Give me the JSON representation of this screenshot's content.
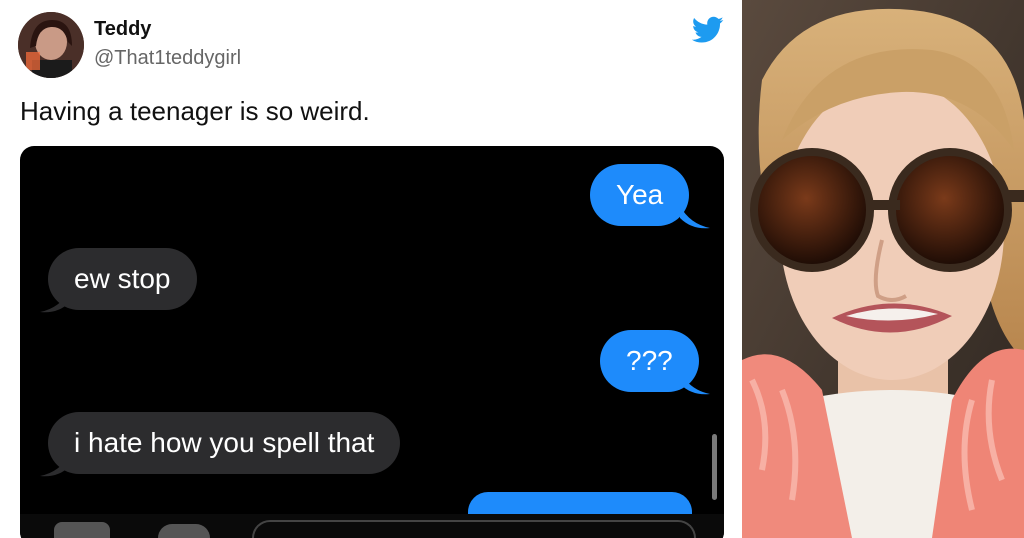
{
  "tweet": {
    "author_name": "Teddy",
    "author_handle": "@That1teddygirl",
    "text": "Having a teenager is so weird."
  },
  "messages": [
    {
      "side": "outgoing",
      "text": "Yea"
    },
    {
      "side": "incoming",
      "text": "ew stop"
    },
    {
      "side": "outgoing",
      "text": "???"
    },
    {
      "side": "incoming",
      "text": "i hate how you spell that"
    }
  ],
  "colors": {
    "outgoing_bubble": "#1e8bfb",
    "incoming_bubble": "#2c2c2e",
    "twitter_blue": "#1d9bf0"
  },
  "icons": [
    "twitter-bird-icon"
  ]
}
